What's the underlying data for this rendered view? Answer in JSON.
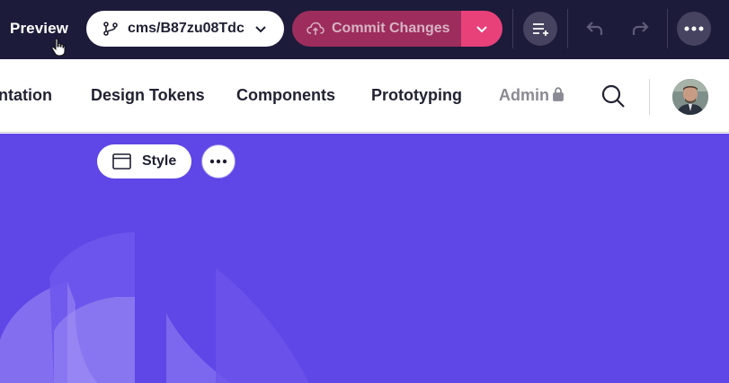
{
  "toolbar": {
    "preview_label": "Preview",
    "branch_label": "cms/B87zu08Tdc",
    "commit_label": "Commit Changes",
    "colors": {
      "bg": "#1d1b3a",
      "commit": "#9d2d5c",
      "commit_drop": "#e8417a"
    }
  },
  "nav": {
    "items": [
      {
        "label": "ntation"
      },
      {
        "label": "Design Tokens"
      },
      {
        "label": "Components"
      },
      {
        "label": "Prototyping"
      },
      {
        "label": "Admin"
      }
    ]
  },
  "hero": {
    "style_label": "Style",
    "colors": {
      "bg": "#5f46e6"
    }
  },
  "icons": [
    "cursor-hand-icon",
    "git-branch-icon",
    "chevron-down-icon",
    "cloud-upload-icon",
    "task-list-icon",
    "undo-icon",
    "redo-icon",
    "more-dots-icon",
    "lock-icon",
    "search-icon",
    "window-icon"
  ]
}
